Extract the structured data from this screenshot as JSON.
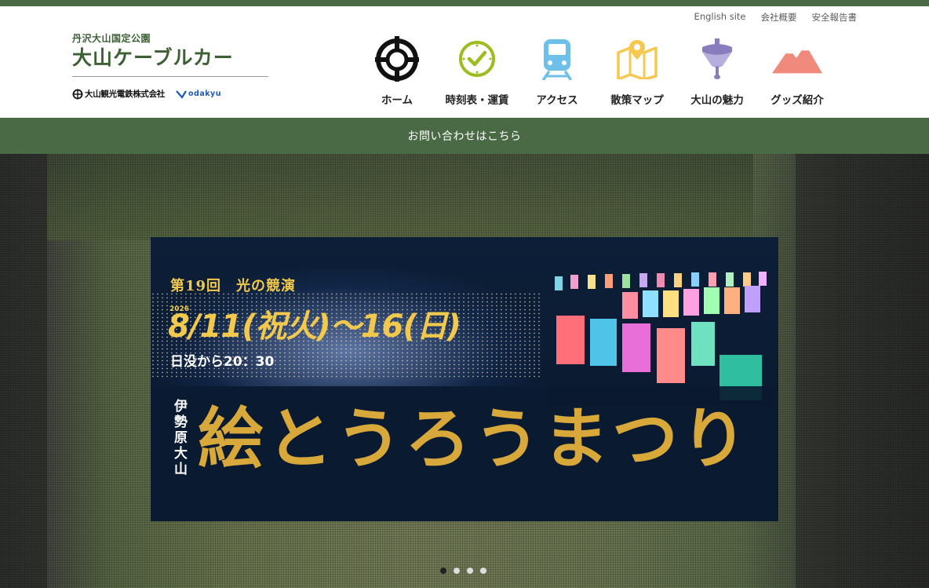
{
  "header": {
    "utility_links": [
      "English site",
      "会社概要",
      "安全報告書"
    ],
    "logo_sub": "丹沢大山国定公園",
    "logo_main": "大山ケーブルカー",
    "partner_company": "大山観光電鉄株式会社",
    "partner_brand": "odakyu"
  },
  "nav": {
    "items": [
      {
        "label": "ホーム",
        "icon": "home-logo-icon"
      },
      {
        "label": "時刻表・運賃",
        "icon": "clock-icon"
      },
      {
        "label": "アクセス",
        "icon": "train-icon"
      },
      {
        "label": "散策マップ",
        "icon": "map-icon"
      },
      {
        "label": "大山の魅力",
        "icon": "spinning-top-icon"
      },
      {
        "label": "グッズ紹介",
        "icon": "mountain-icon"
      }
    ]
  },
  "contact_bar": {
    "label": "お問い合わせはこちら"
  },
  "banner": {
    "edition": "第19回　光の競演",
    "year": "2026",
    "dates": "8/11(祝火)～16(日)",
    "time": "日没から20：30",
    "place": "伊勢原大山",
    "title": "絵とうろうまつり"
  },
  "slider": {
    "count": 4,
    "active_index": 0
  },
  "colors": {
    "brand_green": "#4a6a46",
    "logo_green": "#3c5f34",
    "clock_green": "#9bbd1f",
    "train_blue": "#6fc0e8",
    "map_yellow": "#f6c84f",
    "top_purple": "#8a7dbd",
    "mountain_salmon": "#ef8a7c",
    "banner_gold": "#f2c94c"
  }
}
